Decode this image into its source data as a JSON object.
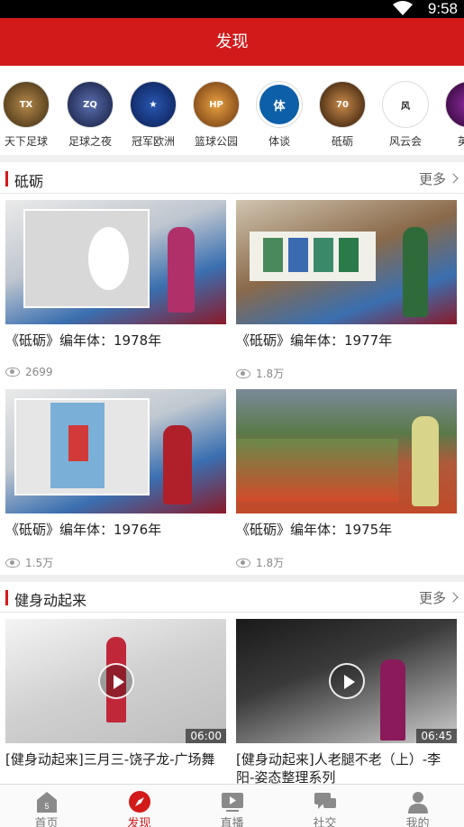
{
  "status_bar": {
    "time": "9:58"
  },
  "header": {
    "title": "发现"
  },
  "channels": [
    {
      "name": "天下足球",
      "color": "#6b4a1a"
    },
    {
      "name": "足球之夜",
      "color": "#23305e"
    },
    {
      "name": "冠军欧洲",
      "color": "#0c2a6b"
    },
    {
      "name": "篮球公园",
      "color": "#b5621a"
    },
    {
      "name": "体谈",
      "color": "#0d5fa8"
    },
    {
      "name": "砥砺",
      "color": "#7a4a1f"
    },
    {
      "name": "风云会",
      "color": "#ffffff"
    },
    {
      "name": "英超",
      "color": "#3c0a4a"
    }
  ],
  "sections": [
    {
      "title": "砥砺",
      "more": "更多",
      "items": [
        {
          "title": "《砥砺》编年体：1978年",
          "views": "2699"
        },
        {
          "title": "《砥砺》编年体：1977年",
          "views": "1.8万"
        },
        {
          "title": "《砥砺》编年体：1976年",
          "views": "1.5万"
        },
        {
          "title": "《砥砺》编年体：1975年",
          "views": "1.8万"
        }
      ]
    },
    {
      "title": "健身动起来",
      "more": "更多",
      "items": [
        {
          "title": "[健身动起来]三月三-饶子龙-广场舞",
          "duration": "06:00"
        },
        {
          "title": "[健身动起来]人老腿不老（上）-李阳-姿态整理系列",
          "duration": "06:45"
        }
      ]
    }
  ],
  "tabs": [
    {
      "label": "首页",
      "icon": "home-icon",
      "badge": "5"
    },
    {
      "label": "发现",
      "icon": "compass-icon",
      "active": true
    },
    {
      "label": "直播",
      "icon": "tv-play-icon"
    },
    {
      "label": "社交",
      "icon": "chat-icon"
    },
    {
      "label": "我的",
      "icon": "person-icon"
    }
  ],
  "colors": {
    "brand_red": "#d21a1a"
  }
}
